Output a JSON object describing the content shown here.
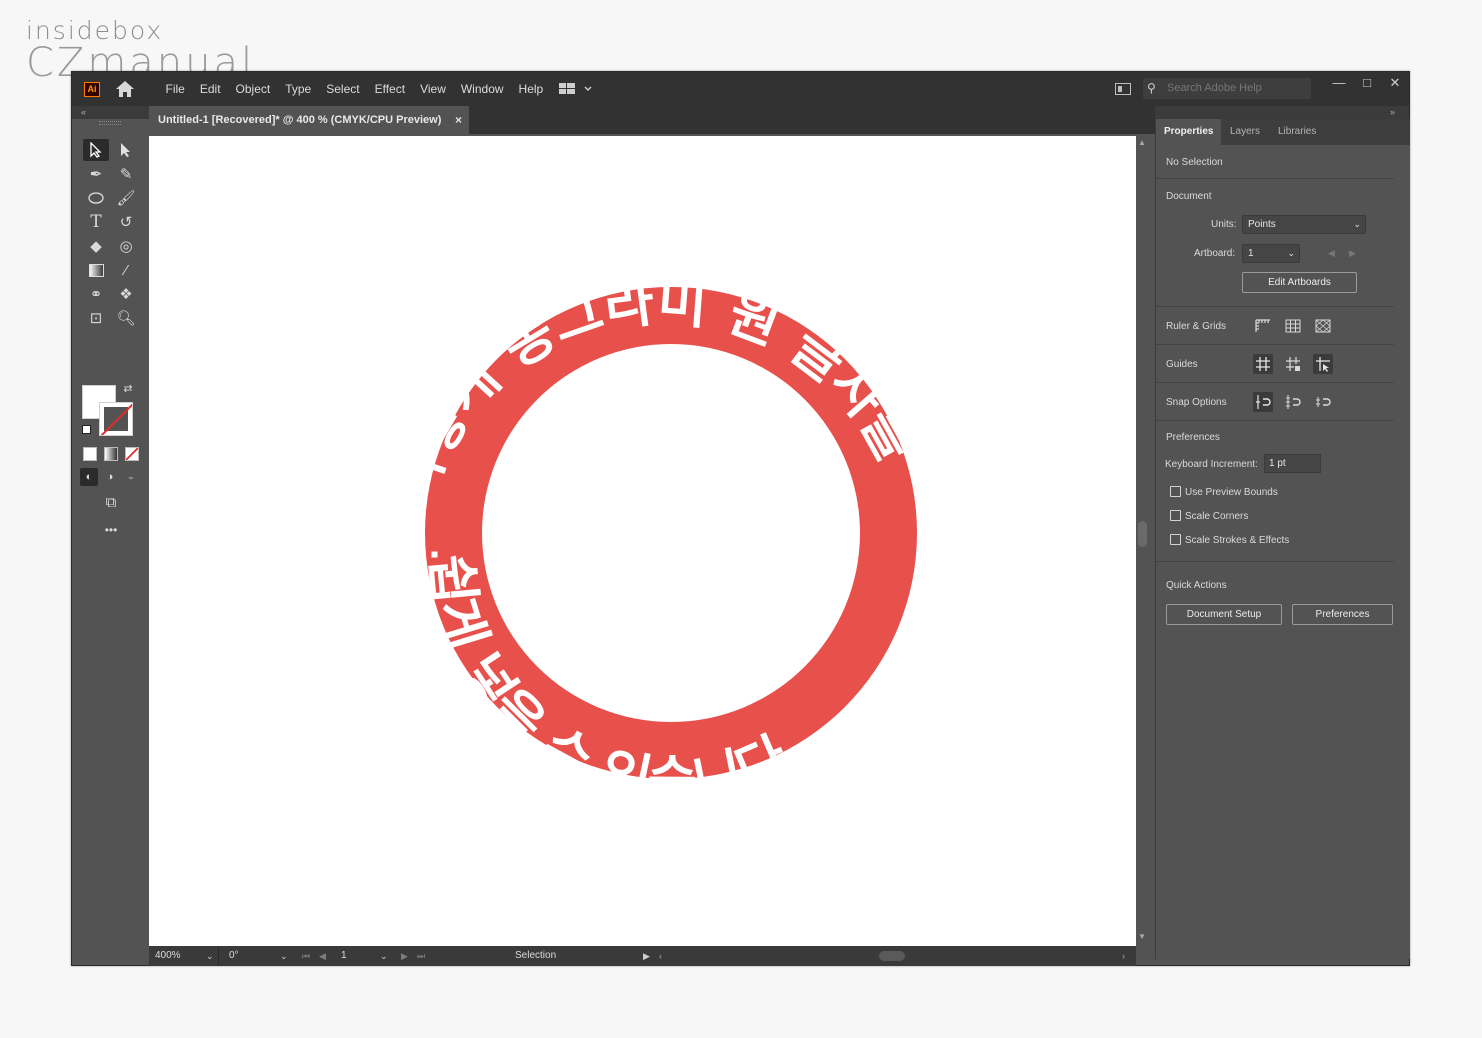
{
  "watermark": {
    "line1": "insidebox",
    "line2": "CZmanual"
  },
  "app": {
    "logo": "Ai",
    "menu": [
      "File",
      "Edit",
      "Object",
      "Type",
      "Select",
      "Effect",
      "View",
      "Window",
      "Help"
    ],
    "search_placeholder": "Search Adobe Help",
    "window_buttons": [
      "—",
      "□",
      "✕"
    ]
  },
  "document": {
    "tab_title": "Untitled-1 [Recovered]* @ 400 % (CMYK/CPU Preview)",
    "tab_close": "×"
  },
  "artwork": {
    "ring_color": "#e8504b",
    "top_text": "이렇게 동그라미 원 글자를",
    "bottom_text": "쉽게 넣을 수 있습니다."
  },
  "status_bar": {
    "zoom": "400%",
    "rotation": "0°",
    "artboard": "1",
    "tool": "Selection"
  },
  "panel": {
    "tabs": [
      "Properties",
      "Layers",
      "Libraries"
    ],
    "selection": "No Selection",
    "document_header": "Document",
    "units_label": "Units:",
    "units_value": "Points",
    "artboard_label": "Artboard:",
    "artboard_value": "1",
    "edit_artboards": "Edit Artboards",
    "ruler_grids": "Ruler & Grids",
    "guides": "Guides",
    "snap_options": "Snap Options",
    "preferences_header": "Preferences",
    "keyboard_increment_label": "Keyboard Increment:",
    "keyboard_increment_value": "1 pt",
    "use_preview_bounds": "Use Preview Bounds",
    "scale_corners": "Scale Corners",
    "scale_strokes": "Scale Strokes & Effects",
    "quick_actions": "Quick Actions",
    "document_setup": "Document Setup",
    "preferences_button": "Preferences"
  }
}
